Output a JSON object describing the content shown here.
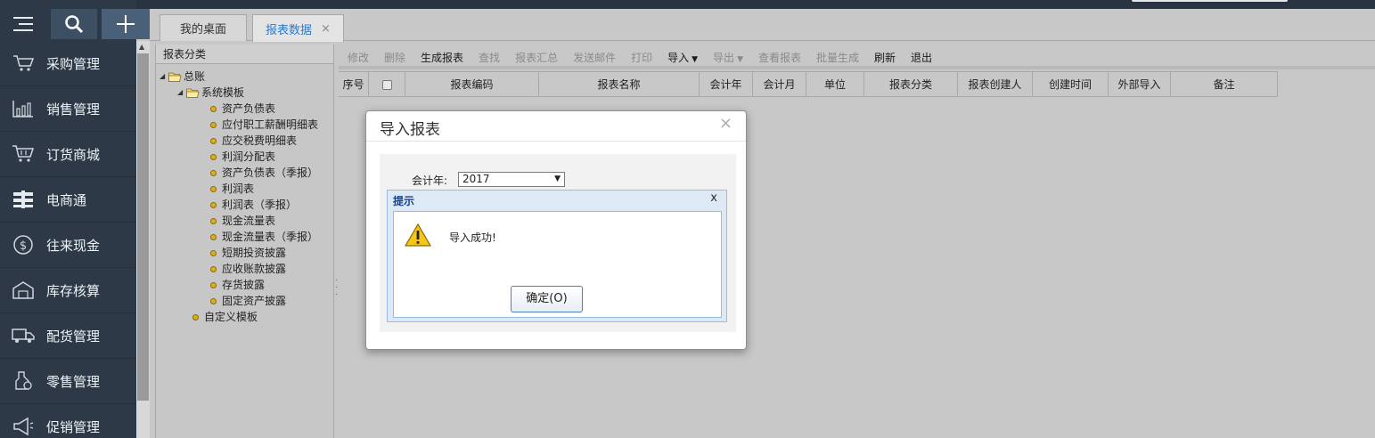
{
  "nav": {
    "items": [
      {
        "label": "采购管理",
        "icon": "cart-icon"
      },
      {
        "label": "销售管理",
        "icon": "chart-icon"
      },
      {
        "label": "订货商城",
        "icon": "shopping-cart-icon"
      },
      {
        "label": "电商通",
        "icon": "ecommerce-icon"
      },
      {
        "label": "往来现金",
        "icon": "dollar-circle-icon"
      },
      {
        "label": "库存核算",
        "icon": "warehouse-icon"
      },
      {
        "label": "配货管理",
        "icon": "truck-icon"
      },
      {
        "label": "零售管理",
        "icon": "retail-icon"
      },
      {
        "label": "促销管理",
        "icon": "megaphone-icon"
      }
    ]
  },
  "tabs": [
    {
      "label": "我的桌面"
    },
    {
      "label": "报表数据",
      "close": "×"
    }
  ],
  "tree": {
    "header": "报表分类",
    "root": "总账",
    "system": "系统模板",
    "leaves": [
      "资产负债表",
      "应付职工薪酬明细表",
      "应交税费明细表",
      "利润分配表",
      "资产负债表（季报）",
      "利润表",
      "利润表（季报）",
      "现金流量表",
      "现金流量表（季报）",
      "短期投资披露",
      "应收账款披露",
      "存货披露",
      "固定资产披露"
    ],
    "custom": "自定义模板"
  },
  "toolbar": [
    "修改",
    "删除",
    "生成报表",
    "查找",
    "报表汇总",
    "发送邮件",
    "打印",
    "导入",
    "导出",
    "查看报表",
    "批量生成",
    "刷新",
    "退出"
  ],
  "grid": {
    "columns": [
      "序号",
      "",
      "报表编码",
      "报表名称",
      "会计年",
      "会计月",
      "单位",
      "报表分类",
      "报表创建人",
      "创建时间",
      "外部导入",
      "备注"
    ]
  },
  "dialog": {
    "title": "导入报表",
    "close": "×",
    "year_label": "会计年:",
    "year_value": "2017"
  },
  "alert": {
    "title": "提示",
    "close": "x",
    "message": "导入成功!",
    "ok_label": "确定(O)"
  }
}
